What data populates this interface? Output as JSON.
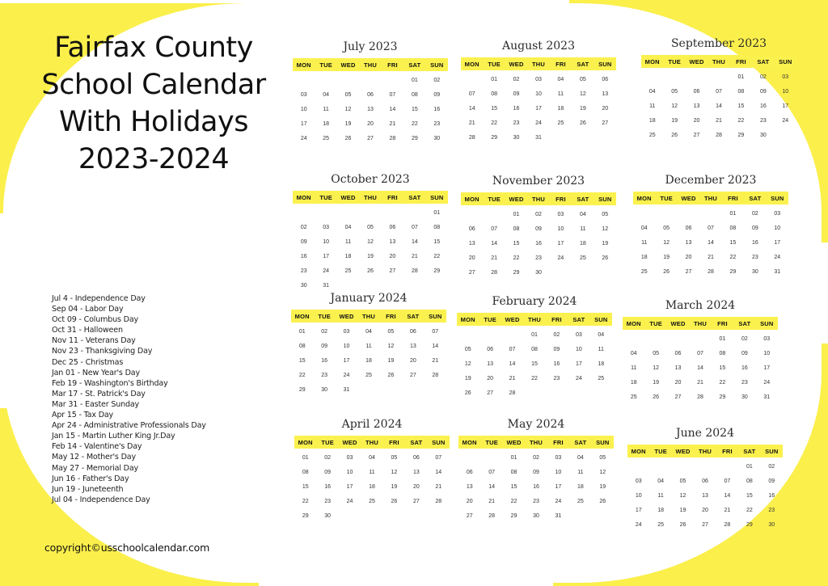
{
  "title_lines": [
    "Fairfax County",
    "School Calendar",
    "With Holidays",
    "2023-2024"
  ],
  "weekday_labels": [
    "MON",
    "TUE",
    "WED",
    "THU",
    "FRI",
    "SAT",
    "SUN"
  ],
  "months": [
    {
      "name": "July 2023",
      "offset": 5,
      "days": 30
    },
    {
      "name": "August 2023",
      "offset": 1,
      "days": 31
    },
    {
      "name": "September 2023",
      "offset": 4,
      "days": 30
    },
    {
      "name": "October 2023",
      "offset": 6,
      "days": 31
    },
    {
      "name": "November 2023",
      "offset": 2,
      "days": 30
    },
    {
      "name": "December 2023",
      "offset": 4,
      "days": 31
    },
    {
      "name": "January 2024",
      "offset": 0,
      "days": 31
    },
    {
      "name": "February 2024",
      "offset": 3,
      "days": 28
    },
    {
      "name": "March 2024",
      "offset": 4,
      "days": 31
    },
    {
      "name": "April 2024",
      "offset": 0,
      "days": 30
    },
    {
      "name": "May 2024",
      "offset": 2,
      "days": 31
    },
    {
      "name": "June 2024",
      "offset": 5,
      "days": 30
    }
  ],
  "holidays": [
    "Jul 4 - Independence Day",
    "Sep 04 - Labor Day",
    "Oct 09 - Columbus Day",
    "Oct 31 - Halloween",
    "Nov 11 - Veterans Day",
    "Nov 23 - Thanksgiving Day",
    "Dec 25 - Christmas",
    "Jan 01 - New Year's Day",
    "Feb 19 - Washington's Birthday",
    "Mar 17 - St. Patrick's Day",
    "Mar 31 - Easter Sunday",
    "Apr 15 - Tax Day",
    "Apr 24 - Administrative Professionals Day",
    "Jan 15 - Martin Luther King Jr.Day",
    "Feb 14 - Valentine's Day",
    "May 12 - Mother's Day",
    "May 27 - Memorial Day",
    "Jun 16 - Father's Day",
    "Jun 19 - Juneteenth",
    "Jul 04 - Independence Day"
  ],
  "copyright": "copyright©usschoolcalendar.com",
  "colors": {
    "accent_yellow": "#fbf14e",
    "background": "#ffffff",
    "text": "#1a1a1a"
  }
}
